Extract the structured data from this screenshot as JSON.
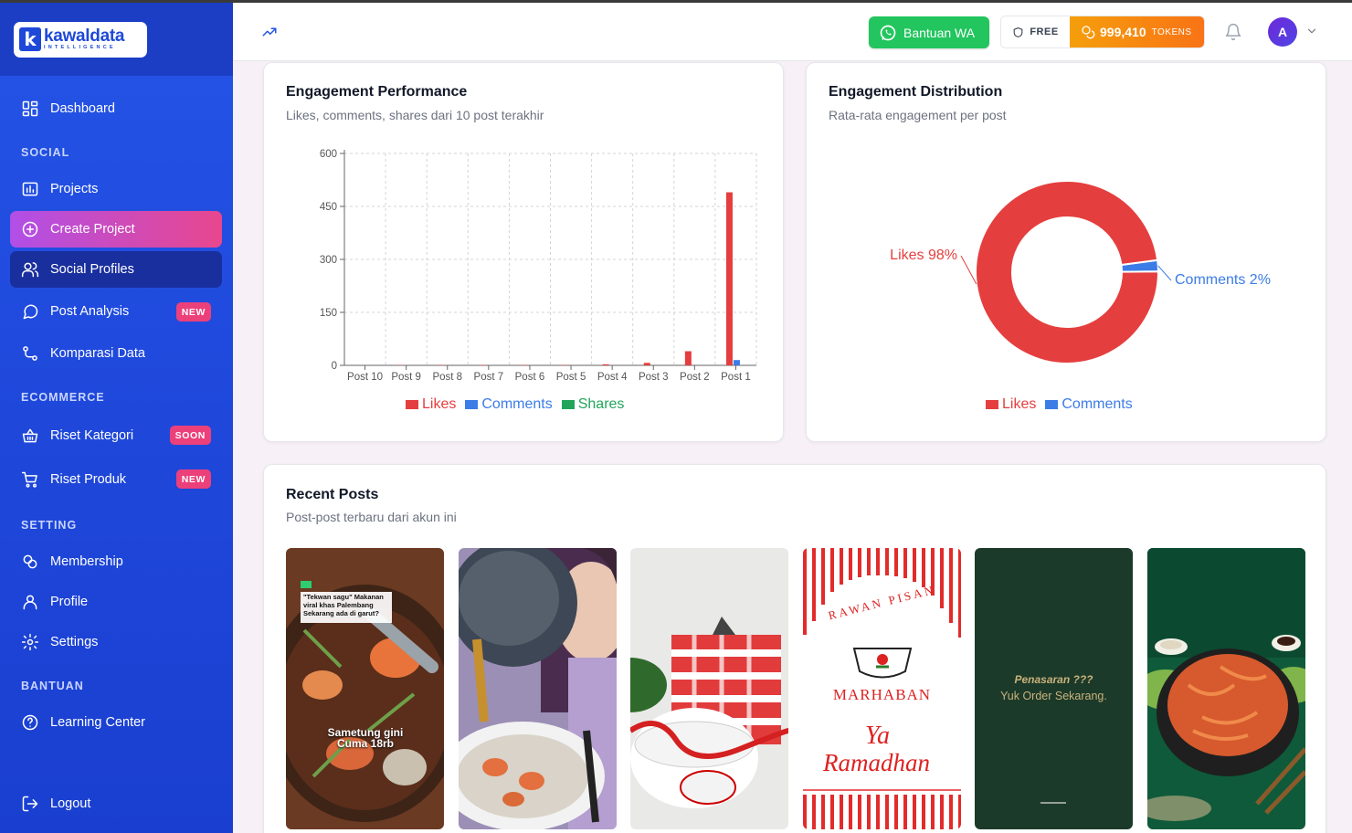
{
  "brand": {
    "logo_letter": "k",
    "name": "kawaldata",
    "tagline": "INTELLIGENCE"
  },
  "sidebar": {
    "sections": {
      "social": "SOCIAL",
      "ecommerce": "ECOMMERCE",
      "setting": "SETTING",
      "bantuan": "BANTUAN"
    },
    "items": {
      "dashboard": "Dashboard",
      "projects": "Projects",
      "create_project": "Create Project",
      "social_profiles": "Social Profiles",
      "post_analysis": "Post Analysis",
      "komparasi": "Komparasi Data",
      "riset_kategori": "Riset Kategori",
      "riset_produk": "Riset Produk",
      "membership": "Membership",
      "profile": "Profile",
      "settings": "Settings",
      "learning": "Learning Center",
      "logout": "Logout"
    },
    "badges": {
      "post_analysis": "NEW",
      "riset_kategori": "SOON",
      "riset_produk": "NEW"
    }
  },
  "header": {
    "wa_label": "Bantuan WA",
    "plan": "FREE",
    "tokens": "999,410",
    "tokens_label": "TOKENS",
    "avatar_letter": "A"
  },
  "cards": {
    "performance": {
      "title": "Engagement Performance",
      "subtitle": "Likes, comments, shares dari 10 post terakhir"
    },
    "distribution": {
      "title": "Engagement Distribution",
      "subtitle": "Rata-rata engagement per post"
    },
    "recent": {
      "title": "Recent Posts",
      "subtitle": "Post-post terbaru dari akun ini",
      "post_texts": {
        "p1_caption": "\"Tekwan sagu\" Makanan viral khas Palembang Sekarang ada di garut?",
        "p1_bottom": "Sametung gini Cuma 18rb",
        "p4_top": "RAWAN PISAN",
        "p4_mid": "MARHABAN",
        "p4_script1": "Ya",
        "p4_script2": "Ramadhan",
        "p5_line1": "Penasaran ???",
        "p5_line2": "Yuk Order Sekarang."
      }
    }
  },
  "colors": {
    "likes": "#e53e3e",
    "comments": "#3b7ce6",
    "shares": "#22a55b",
    "sidebar": "#2454e6"
  },
  "chart_data": [
    {
      "type": "bar",
      "title": "Engagement Performance",
      "categories": [
        "Post 10",
        "Post 9",
        "Post 8",
        "Post 7",
        "Post 6",
        "Post 5",
        "Post 4",
        "Post 3",
        "Post 2",
        "Post 1"
      ],
      "series": [
        {
          "name": "Likes",
          "values": [
            0,
            1,
            1,
            1,
            1,
            1,
            3,
            7,
            40,
            490
          ]
        },
        {
          "name": "Comments",
          "values": [
            0,
            0,
            0,
            0,
            0,
            0,
            0,
            0,
            0,
            15
          ]
        },
        {
          "name": "Shares",
          "values": [
            0,
            0,
            0,
            0,
            0,
            0,
            0,
            0,
            0,
            0
          ]
        }
      ],
      "yticks": [
        0,
        150,
        300,
        450,
        600
      ],
      "ylim": [
        0,
        600
      ],
      "grid": true,
      "legend": "bottom"
    },
    {
      "type": "pie",
      "title": "Engagement Distribution",
      "donut": true,
      "slices": [
        {
          "name": "Likes",
          "label": "Likes 98%",
          "value": 98
        },
        {
          "name": "Comments",
          "label": "Comments 2%",
          "value": 2
        }
      ],
      "legend": "bottom"
    }
  ]
}
